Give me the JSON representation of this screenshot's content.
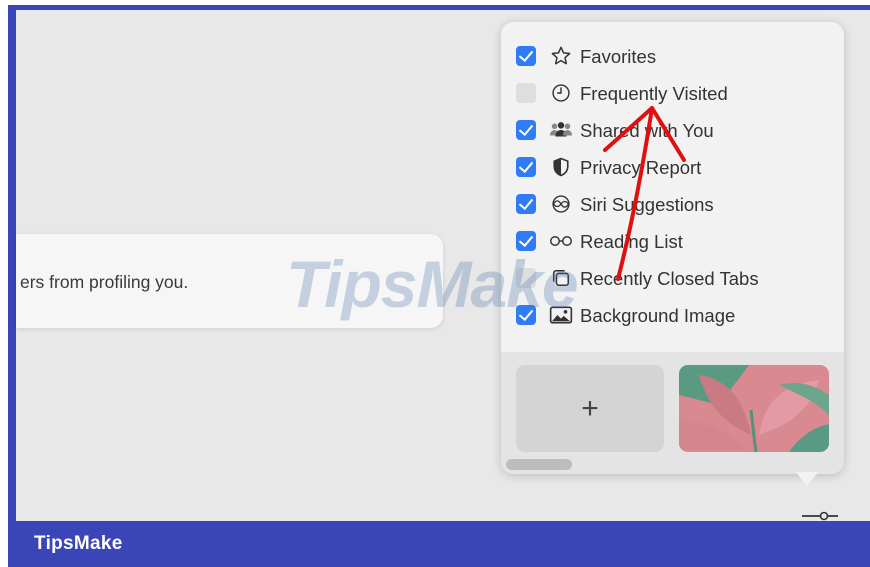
{
  "tooltip": {
    "text": "ers from profiling you."
  },
  "menu": {
    "items": [
      {
        "label": "Favorites",
        "checked": true,
        "icon": "star-icon"
      },
      {
        "label": "Frequently Visited",
        "checked": false,
        "icon": "clock-icon"
      },
      {
        "label": "Shared with You",
        "checked": true,
        "icon": "people-icon"
      },
      {
        "label": "Privacy Report",
        "checked": true,
        "icon": "shield-icon"
      },
      {
        "label": "Siri Suggestions",
        "checked": true,
        "icon": "siri-icon"
      },
      {
        "label": "Reading List",
        "checked": true,
        "icon": "glasses-icon"
      },
      {
        "label": "Recently Closed Tabs",
        "checked": false,
        "icon": "tabs-icon"
      },
      {
        "label": "Background Image",
        "checked": true,
        "icon": "image-icon"
      }
    ]
  },
  "background": {
    "add_label": "+"
  },
  "watermark": "TipsMake",
  "footer": {
    "brand": "TipsMake"
  },
  "colors": {
    "accent": "#2f7cf6",
    "frame": "#3a46b8",
    "annotation": "#e01010"
  }
}
